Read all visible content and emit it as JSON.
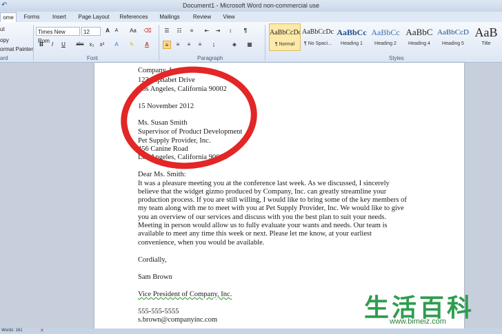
{
  "window": {
    "title": "Document1 - Microsoft Word non-commercial use"
  },
  "tabs": [
    "ome",
    "Forms",
    "Insert",
    "Page Layout",
    "References",
    "Mailings",
    "Review",
    "View"
  ],
  "clipboard": {
    "cut": "ut",
    "copy": "opy",
    "painter": "ormat Painter",
    "label": "ard"
  },
  "font": {
    "name": "Times New Rom",
    "size": "12",
    "label": "Font",
    "grow": "A",
    "shrink": "A",
    "case": "Aa",
    "bold": "B",
    "italic": "I",
    "underline": "U",
    "strike": "abc",
    "sub": "x₂",
    "sup": "x²"
  },
  "paragraph": {
    "label": "Paragraph"
  },
  "styles": {
    "label": "Styles",
    "items": [
      {
        "preview": "AaBbCcDc",
        "name": "¶ Normal"
      },
      {
        "preview": "AaBbCcDc",
        "name": "¶ No Spaci..."
      },
      {
        "preview": "AaBbCc",
        "name": "Heading 1"
      },
      {
        "preview": "AaBbCc",
        "name": "Heading 2"
      },
      {
        "preview": "AaBbC",
        "name": "Heading 4"
      },
      {
        "preview": "AaBbCcD",
        "name": "Heading 5"
      },
      {
        "preview": "AaB",
        "name": "Title"
      }
    ]
  },
  "document": {
    "lines": [
      "Company, Inc.",
      "123 Alphabet Drive",
      "Los Angeles, California 90002",
      "",
      "15 November 2012",
      "",
      "Ms. Susan Smith",
      "Supervisor of Product Development",
      "Pet Supply Provider, Inc.",
      "456 Canine Road",
      "Los Angeles, California 90002",
      "",
      "Dear Ms. Smith:",
      "It was a pleasure meeting you at the conference last week. As we discussed, I sincerely",
      "believe that the widget gizmo produced by Company, Inc. can greatly streamline  your",
      "production process. If you are still willing, I would like to bring some of the key members  of",
      "my team along with me to meet with you at Pet Supply Provider, Inc. We would like to give",
      "you an overview of our services  and discuss with you the best plan to suit your needs.",
      "Meeting in person would allow us to fully evaluate your wants and needs. Our team is",
      "available to meet any time this week or next. Please let me know, at your earliest",
      "convenience, when you would be available.",
      "",
      "Cordially,",
      "",
      "Sam Brown",
      "",
      "Vice President of Company, Inc.",
      "",
      "555-555-5555",
      "s.brown@companyinc.com"
    ]
  },
  "status": {
    "words": "Words: 161"
  },
  "watermark": {
    "text": "生活百科",
    "url": "www.bimeiz.com"
  }
}
